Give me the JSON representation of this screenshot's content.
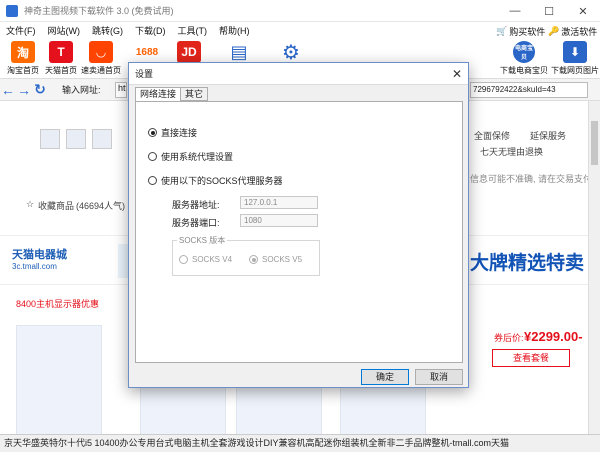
{
  "window": {
    "title": "神奇主图视频下载软件 3.0 (免费试用)",
    "controls": {
      "minimize": "—",
      "maximize": "☐",
      "close": "✕"
    }
  },
  "menu": [
    "文件(F)",
    "网站(W)",
    "跳转(G)",
    "下载(D)",
    "工具(T)",
    "帮助(H)"
  ],
  "toolbar": {
    "items": [
      {
        "label": "淘宝首页",
        "glyph": "淘",
        "color": "#ff6a00"
      },
      {
        "label": "天猫首页",
        "glyph": "T",
        "color": "#e4101b"
      },
      {
        "label": "速卖通首页",
        "glyph": "◡",
        "color": "#ff4400"
      },
      {
        "label": "",
        "glyph": "1688",
        "color": "#ff6000"
      },
      {
        "label": "",
        "glyph": "JD",
        "color": "#e1251b"
      },
      {
        "label": "",
        "glyph": "▤",
        "color": "#2a66c8"
      },
      {
        "label": "",
        "glyph": "⚙",
        "color": "#2a66c8"
      },
      {
        "label": "下载电商宝贝",
        "glyph": "电商宝贝",
        "color": "#2a66c8"
      },
      {
        "label": "下载网页图片",
        "glyph": "⬇",
        "color": "#2a66c8"
      }
    ],
    "buy_label": "购买软件",
    "activate_label": "激活软件"
  },
  "addressbar": {
    "label": "输入网址:",
    "value_head": "http",
    "value_tail": "7296792422&skuId=43"
  },
  "page": {
    "collect_text": "收藏商品",
    "popularity": "(46694人气)",
    "service_1": "全面保修",
    "service_2": "延保服务",
    "service_3": "七天无理由退换",
    "notice": "信息可能不准确, 请在交易支付",
    "tmall_name": "天猫电器城",
    "tmall_domain": "3c.tmall.com",
    "banner_slogan": "大牌精选特卖",
    "section_title": "8400主机显示器优惠",
    "price_label": "券后价:",
    "price_value": "¥2299.00-",
    "view_button": "查看套餐"
  },
  "status": {
    "text": "京天华盛英特尔十代i5 10400办公专用台式电脑主机全套游戏设计DIY兼容机高配迷你组装机全新非二手品牌整机-tmall.com天猫"
  },
  "dialog": {
    "title": "设置",
    "close": "✕",
    "tabs": [
      "网络连接",
      "其它"
    ],
    "options": {
      "direct": "直接连接",
      "system_proxy": "使用系统代理设置",
      "socks_proxy": "使用以下的SOCKS代理服务器"
    },
    "selected": "direct",
    "server_address_label": "服务器地址:",
    "server_address_value": "127.0.0.1",
    "server_port_label": "服务器端口:",
    "server_port_value": "1080",
    "socks_version_title": "SOCKS 版本",
    "socks_v4": "SOCKS V4",
    "socks_v5": "SOCKS V5",
    "socks_selected": "V5",
    "ok_label": "确定",
    "cancel_label": "取消"
  }
}
